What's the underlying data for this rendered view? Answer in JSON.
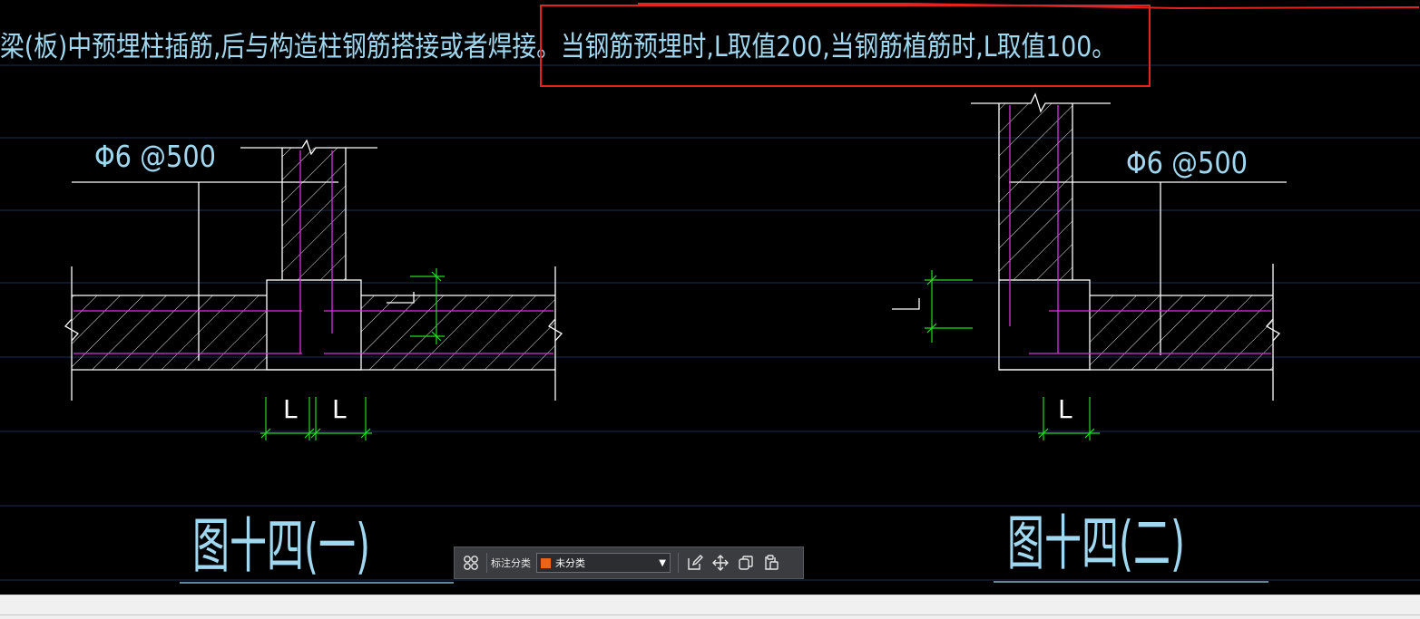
{
  "drawing": {
    "note_text": "梁(板)中预埋柱插筋,后与构造柱钢筋搭接或者焊接。当钢筋预埋时,L取值200,当钢筋植筋时,L取值100。",
    "rebar_left": "Φ6 @500",
    "rebar_right": "Φ6 @500",
    "dim_label": "L",
    "fig1_title": "图十四(一)",
    "fig2_title": "图十四(二)"
  },
  "toolbar": {
    "label": "标注分类",
    "selected": "未分类",
    "swatch_color": "#e8651a"
  },
  "colors": {
    "background": "#000000",
    "line": "#ffffff",
    "rebar": "#e030e0",
    "dimension": "#22dd22",
    "text": "#9fd8f0",
    "highlight": "#e52222",
    "grid": "#1c2c58"
  }
}
